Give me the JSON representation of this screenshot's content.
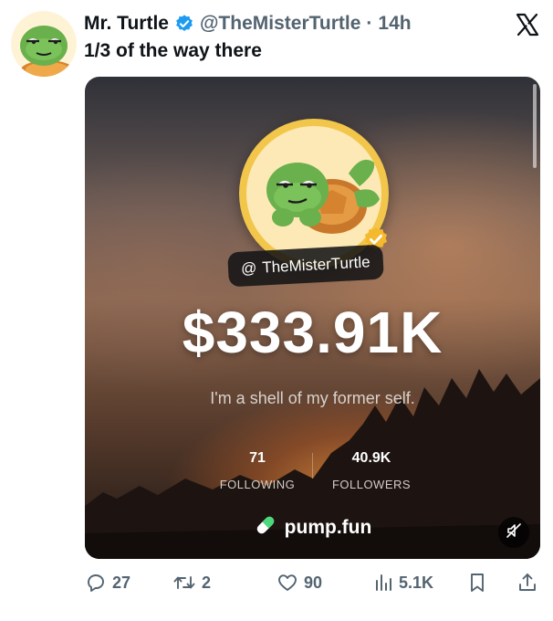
{
  "tweet": {
    "display_name": "Mr. Turtle",
    "handle": "@TheMisterTurtle",
    "separator": "·",
    "time": "14h",
    "text": "1/3 of the way there"
  },
  "card": {
    "at_symbol": "@",
    "username": "TheMisterTurtle",
    "balance": "$333.91K",
    "bio": "I'm a shell of my former self.",
    "following_count": "71",
    "following_label": "FOLLOWING",
    "followers_count": "40.9K",
    "followers_label": "FOLLOWERS",
    "brand": "pump.fun"
  },
  "actions": {
    "replies": "27",
    "reposts": "2",
    "likes": "90",
    "views": "5.1K"
  },
  "icons": {
    "verified": "verified-badge-icon",
    "x_logo": "x-logo-icon",
    "reply": "reply-icon",
    "repost": "repost-icon",
    "like": "heart-icon",
    "views": "views-icon",
    "bookmark": "bookmark-icon",
    "share": "share-icon",
    "mute": "muted-speaker-icon",
    "pill": "pill-icon"
  },
  "colors": {
    "verified_blue": "#1d9bf0",
    "muted_text": "#536471",
    "card_avatar_ring": "#f2c64b",
    "turtle_green": "#6ab04c"
  }
}
